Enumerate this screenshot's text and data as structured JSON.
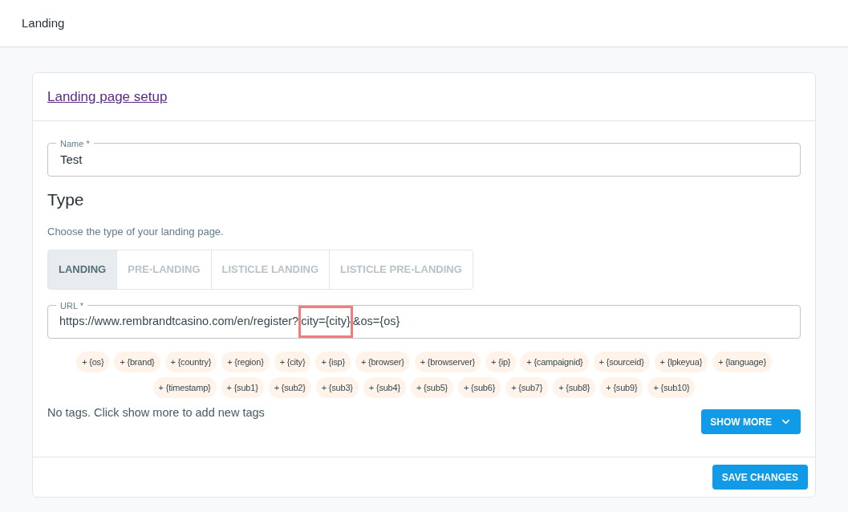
{
  "header": {
    "title": "Landing"
  },
  "card": {
    "title": "Landing page setup",
    "name_field": {
      "label": "Name *",
      "value": "Test"
    },
    "type_heading": "Type",
    "type_hint": "Choose the type of your landing page.",
    "tabs": [
      {
        "label": "LANDING",
        "selected": true
      },
      {
        "label": "PRE-LANDING",
        "selected": false
      },
      {
        "label": "LISTICLE LANDING",
        "selected": false
      },
      {
        "label": "LISTICLE PRE-LANDING",
        "selected": false
      }
    ],
    "url_field": {
      "label": "URL *",
      "value_parts": [
        {
          "text": "https://www.rembrandtcasino.com/en/register?",
          "highlighted": false
        },
        {
          "text": "city={city}",
          "highlighted": true
        },
        {
          "text": "&os={os}",
          "highlighted": false
        }
      ]
    },
    "tags": [
      "+ {os}",
      "+ {brand}",
      "+ {country}",
      "+ {region}",
      "+ {city}",
      "+ {isp}",
      "+ {browser}",
      "+ {browserver}",
      "+ {ip}",
      "+ {campaignid}",
      "+ {sourceid}",
      "+ {lpkeyua}",
      "+ {language}",
      "+ {timestamp}",
      "+ {sub1}",
      "+ {sub2}",
      "+ {sub3}",
      "+ {sub4}",
      "+ {sub5}",
      "+ {sub6}",
      "+ {sub7}",
      "+ {sub8}",
      "+ {sub9}",
      "+ {sub10}"
    ],
    "no_tags_text": "No tags. Click show more to add new tags",
    "show_more_button": "SHOW MORE",
    "save_button": "SAVE CHANGES"
  }
}
